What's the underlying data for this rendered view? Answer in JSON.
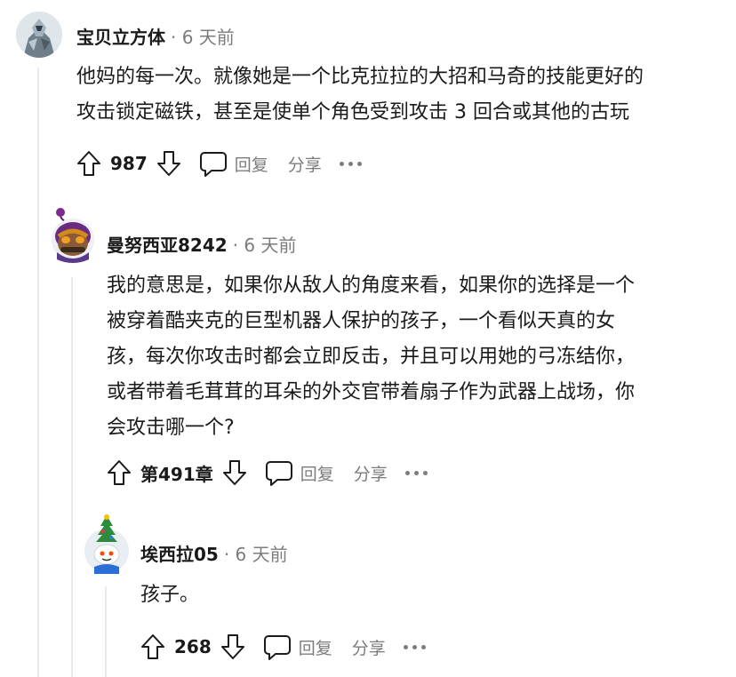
{
  "comments": [
    {
      "username": "宝贝立方体",
      "time": "· 6 天前",
      "lines": [
        "他妈的每一次。就像她是一个比克拉拉的大招和马奇的技能更好的",
        "攻击锁定磁铁，甚至是使单个角色受到攻击 3 回合或其他的古玩"
      ],
      "score": "987",
      "reply_label": "回复",
      "share_label": "分享"
    },
    {
      "username": "曼努西亚8242",
      "time": "· 6 天前",
      "lines": [
        "我的意思是，如果你从敌人的角度来看，如果你的选择是一个",
        "被穿着酷夹克的巨型机器人保护的孩子，一个看似天真的女",
        "孩，每次你攻击时都会立即反击，并且可以用她的弓冻结你，",
        "或者带着毛茸茸的耳朵的外交官带着扇子作为武器上战场，你",
        "会攻击哪一个?"
      ],
      "score": "第491章",
      "reply_label": "回复",
      "share_label": "分享"
    },
    {
      "username": "埃西拉05",
      "time": "· 6 天前",
      "lines": [
        "孩子。"
      ],
      "score": "268",
      "reply_label": "回复",
      "share_label": "分享"
    }
  ],
  "colors": {
    "text": "#1a1a1b",
    "muted": "#7c7c7c",
    "thread_line": "#e8ebed"
  },
  "icons": [
    "upvote-icon",
    "downvote-icon",
    "reply-icon",
    "more-icon"
  ]
}
